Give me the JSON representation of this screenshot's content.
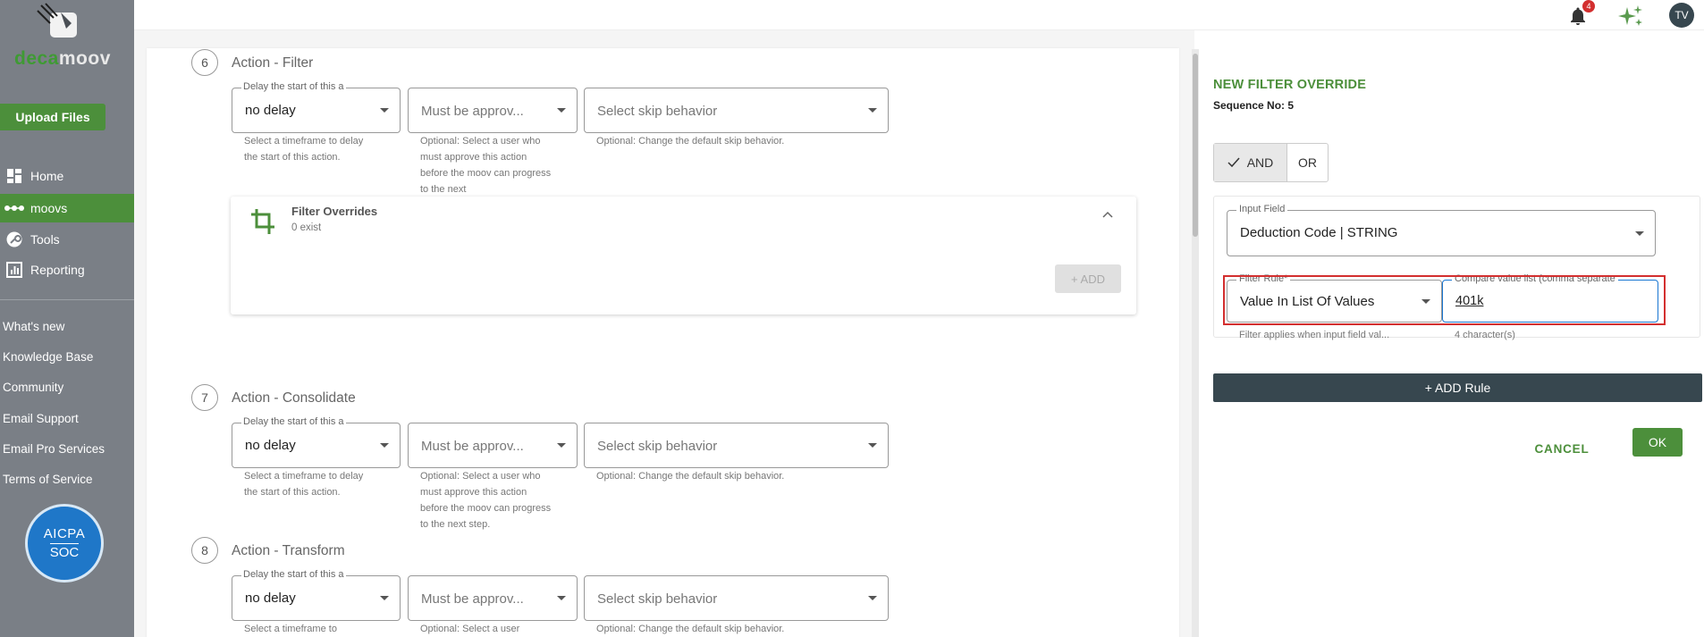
{
  "sidebar": {
    "logo_text_green": "deca",
    "logo_text_white": "moov",
    "upload_label": "Upload Files",
    "nav": [
      {
        "label": "Home",
        "icon": "dashboard-icon"
      },
      {
        "label": "moovs",
        "icon": "dots-icon"
      },
      {
        "label": "Tools",
        "icon": "wrench-icon"
      },
      {
        "label": "Reporting",
        "icon": "chart-icon"
      }
    ],
    "links": [
      "What's new",
      "Knowledge Base",
      "Community",
      "Email Support",
      "Email Pro Services",
      "Terms of Service"
    ],
    "badge": {
      "line1": "AICPA",
      "line2": "SOC"
    }
  },
  "topbar": {
    "notification_count": "4",
    "avatar_initials": "TV"
  },
  "steps": [
    {
      "number": "6",
      "title": "Action - Filter",
      "delay_label": "Delay the start of this a",
      "delay_value": "no delay",
      "delay_help": "Select a timeframe to delay the start of this action.",
      "approve_placeholder": "Must be approv...",
      "approve_help": "Optional: Select a user who must approve this action before the moov can progress to the next",
      "skip_placeholder": "Select skip behavior",
      "skip_help": "Optional: Change the default skip behavior."
    },
    {
      "number": "7",
      "title": "Action - Consolidate",
      "delay_label": "Delay the start of this a",
      "delay_value": "no delay",
      "delay_help": "Select a timeframe to delay the start of this action.",
      "approve_placeholder": "Must be approv...",
      "approve_help": "Optional: Select a user who must approve this action before the moov can progress to the next step.",
      "skip_placeholder": "Select skip behavior",
      "skip_help": "Optional: Change the default skip behavior."
    },
    {
      "number": "8",
      "title": "Action - Transform",
      "delay_label": "Delay the start of this a",
      "delay_value": "no delay",
      "delay_help": "Select a timeframe to",
      "approve_placeholder": "Must be approv...",
      "approve_help": "Optional: Select a user",
      "skip_placeholder": "Select skip behavior",
      "skip_help": "Optional: Change the default skip behavior."
    }
  ],
  "filter_overrides": {
    "title": "Filter Overrides",
    "subtitle": "0 exist",
    "add_label": "+ ADD"
  },
  "panel": {
    "title": "NEW FILTER OVERRIDE",
    "sequence": "Sequence No: 5",
    "and_label": "AND",
    "or_label": "OR",
    "input_field_label": "Input Field",
    "input_field_value": "Deduction Code | STRING",
    "filter_rule_label": "Filter Rule*",
    "filter_rule_value": "Value In List Of Values",
    "filter_rule_help": "Filter applies when input field val...",
    "compare_label": "Compare value list (comma separate",
    "compare_value": "401k",
    "compare_help": "4 character(s)",
    "add_rule_label": "+ ADD Rule",
    "cancel_label": "CANCEL",
    "ok_label": "OK"
  }
}
